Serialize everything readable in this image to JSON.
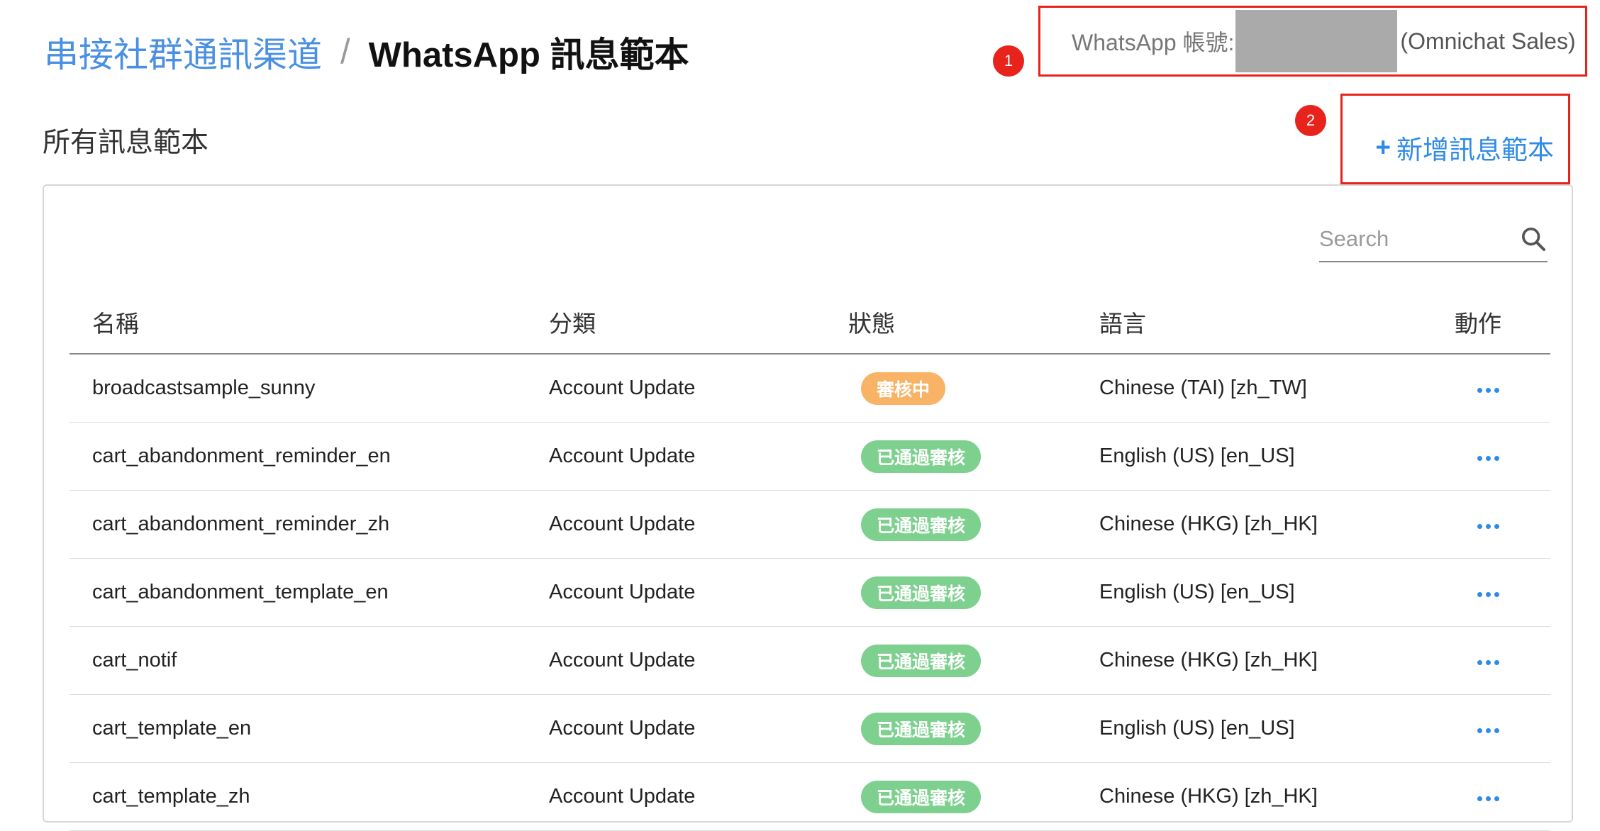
{
  "breadcrumb": {
    "parent": "串接社群通訊渠道",
    "separator": "/",
    "current": "WhatsApp 訊息範本"
  },
  "account": {
    "label": "WhatsApp 帳號:",
    "name": "(Omnichat Sales)"
  },
  "callouts": [
    "1",
    "2"
  ],
  "section": {
    "title": "所有訊息範本",
    "add_button": "新增訊息範本",
    "add_button_prefix": "+"
  },
  "search": {
    "placeholder": "Search",
    "icon": "search-icon"
  },
  "table": {
    "headers": {
      "name": "名稱",
      "category": "分類",
      "status": "狀態",
      "language": "語言",
      "action": "動作"
    },
    "rows": [
      {
        "name": "broadcastsample_sunny",
        "category": "Account Update",
        "status": "審核中",
        "status_type": "pending",
        "language": "Chinese (TAI) [zh_TW]"
      },
      {
        "name": "cart_abandonment_reminder_en",
        "category": "Account Update",
        "status": "已通過審核",
        "status_type": "approved",
        "language": "English (US) [en_US]"
      },
      {
        "name": "cart_abandonment_reminder_zh",
        "category": "Account Update",
        "status": "已通過審核",
        "status_type": "approved",
        "language": "Chinese (HKG) [zh_HK]"
      },
      {
        "name": "cart_abandonment_template_en",
        "category": "Account Update",
        "status": "已通過審核",
        "status_type": "approved",
        "language": "English (US) [en_US]"
      },
      {
        "name": "cart_notif",
        "category": "Account Update",
        "status": "已通過審核",
        "status_type": "approved",
        "language": "Chinese (HKG) [zh_HK]"
      },
      {
        "name": "cart_template_en",
        "category": "Account Update",
        "status": "已通過審核",
        "status_type": "approved",
        "language": "English (US) [en_US]"
      },
      {
        "name": "cart_template_zh",
        "category": "Account Update",
        "status": "已通過審核",
        "status_type": "approved",
        "language": "Chinese (HKG) [zh_HK]"
      }
    ]
  },
  "colors": {
    "link": "#4a90e2",
    "accent": "#2f8be6",
    "highlight": "#e8231c",
    "pending": "#f8b366",
    "approved": "#7ed08f"
  }
}
